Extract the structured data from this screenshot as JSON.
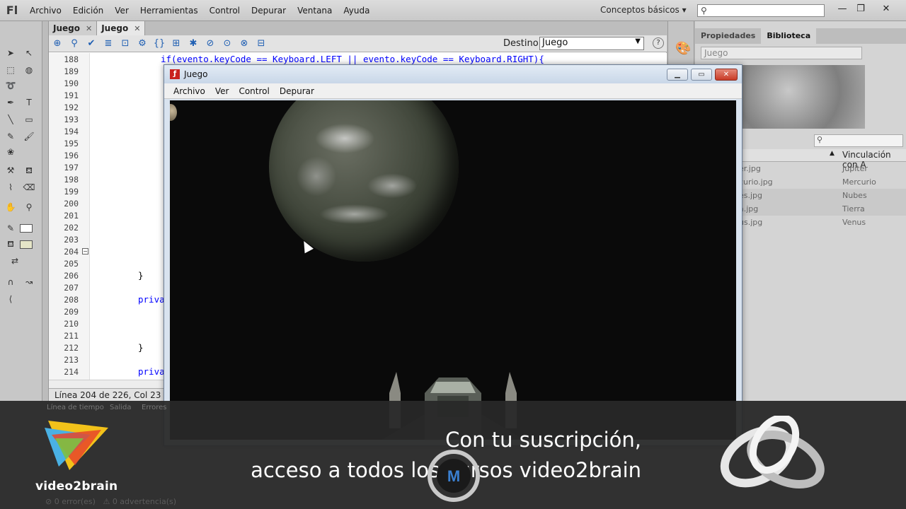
{
  "app": {
    "logo": "Fl",
    "menu": [
      "Archivo",
      "Edición",
      "Ver",
      "Herramientas",
      "Control",
      "Depurar",
      "Ventana",
      "Ayuda"
    ],
    "workspace": "Conceptos básicos",
    "window_controls": {
      "minimize": "—",
      "restore": "❐",
      "close": "✕"
    }
  },
  "editor": {
    "tabs": [
      {
        "label": "Juego",
        "close": "✕"
      },
      {
        "label": "Juego",
        "close": "✕"
      }
    ],
    "destination_label": "Destino:",
    "destination_value": "Juego",
    "help": "?",
    "line_numbers": [
      "188",
      "189",
      "190",
      "191",
      "192",
      "193",
      "194",
      "195",
      "196",
      "197",
      "198",
      "199",
      "200",
      "201",
      "202",
      "203",
      "204",
      "205",
      "206",
      "207",
      "208",
      "209",
      "210",
      "211",
      "212",
      "213",
      "214"
    ],
    "visible_code": {
      "line188": "if(evento.keyCode == Keyboard.LEFT || evento.keyCode == Keyboard.RIGHT){",
      "line206": "}",
      "line208": "priva",
      "line212": "}",
      "line214": "priva"
    },
    "status": "Línea 204 de 226, Col 23"
  },
  "bottom_panel": {
    "tabs": [
      "Línea de tiempo",
      "Salida",
      "Errores"
    ],
    "errors": "0 error(es)",
    "warnings": "0 advertencia(s)"
  },
  "library": {
    "tabs": [
      "Propiedades",
      "Biblioteca"
    ],
    "selected_doc": "Juego",
    "column_linkage": "Vinculación con A",
    "items": [
      {
        "name": "er.jpg",
        "linkage": "Jupiter"
      },
      {
        "name": "curio.jpg",
        "linkage": "Mercurio"
      },
      {
        "name": "es.jpg",
        "linkage": "Nubes"
      },
      {
        "name": "a.jpg",
        "linkage": "Tierra"
      },
      {
        "name": "us.jpg",
        "linkage": "Venus"
      }
    ]
  },
  "player": {
    "title": "Juego",
    "menu": [
      "Archivo",
      "Ver",
      "Control",
      "Depurar"
    ]
  },
  "overlay": {
    "brand": "video2brain",
    "line1": "Con tu suscripción,",
    "line2": "acceso a todos los cursos video2brain"
  }
}
